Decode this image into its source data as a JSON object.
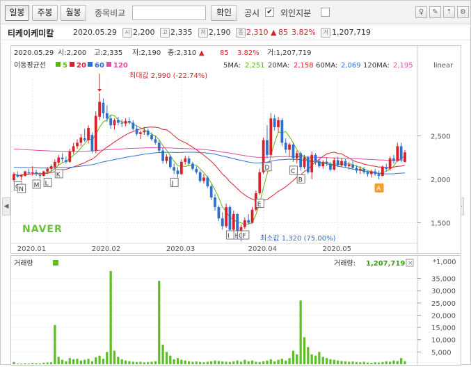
{
  "toolbar": {
    "periods": [
      "일봉",
      "주봉",
      "월봉"
    ],
    "compare_label": "종목비교",
    "confirm_label": "확인",
    "notice_label": "공시",
    "notice_checked": "✔",
    "foreign_label": "외인지분"
  },
  "info": {
    "name": "티케이케미칼",
    "date": "2020.05.29",
    "open_badge": "시",
    "open": "2,200",
    "high_badge": "고",
    "high": "2,335",
    "low_badge": "저",
    "low": "2,190",
    "close_badge": "종",
    "close": "2,310",
    "change_arrow": "▲",
    "change": "85",
    "change_pct": "3.82%",
    "volume_badge": "거",
    "volume": "1,207,719"
  },
  "price_pane": {
    "summary_date": "2020.05.29",
    "summary_open": "시:2,200",
    "summary_high": "고:2,335",
    "summary_low": "저:2,190",
    "summary_close": "종:2,310",
    "summary_arrow": "▲",
    "summary_change": "85",
    "summary_pct": "3.82%",
    "summary_volume": "거:1,207,719",
    "ma_title": "이동평균선",
    "ma_legend": [
      {
        "label": "5",
        "color": "#5bb516"
      },
      {
        "label": "20",
        "color": "#d6232a"
      },
      {
        "label": "60",
        "color": "#2f6fd0"
      },
      {
        "label": "120",
        "color": "#e24ba6"
      }
    ],
    "ma_values": [
      {
        "label": "5MA:",
        "value": "2,251",
        "color": "#5bb516"
      },
      {
        "label": "20MA:",
        "value": "2,158",
        "color": "#d6232a"
      },
      {
        "label": "60MA:",
        "value": "2,069",
        "color": "#2f6fd0"
      },
      {
        "label": "120MA:",
        "value": "2,195",
        "color": "#e24ba6"
      }
    ],
    "scale_label": "linear",
    "max_label": "최대값 2,990 (-22.74%)",
    "min_label": "최소값 1,320 (75.00%)",
    "logo": "NAVER"
  },
  "volume_pane": {
    "title": "거래량",
    "legend_label": "거래량:",
    "legend_value": "1,207,719",
    "unit": "*1,000"
  },
  "colors": {
    "up": "#d6232a",
    "down": "#2f6fd0",
    "ma5": "#5bb516",
    "ma20": "#d6232a",
    "ma60": "#2f6fd0",
    "ma120": "#e24ba6",
    "volume": "#5bbe24",
    "event": "#f0a030"
  },
  "chart_data": [
    {
      "type": "candlestick",
      "title": "티케이케미칼",
      "scale": "linear",
      "x_ticks": [
        "2020.01",
        "2020.02",
        "2020.03",
        "2020.04",
        "2020.05"
      ],
      "y_ticks": [
        1500,
        2000,
        2500
      ],
      "ylim": [
        1280,
        3150
      ],
      "candles": [
        {
          "d": "2019-12-23",
          "o": 1990,
          "h": 2080,
          "l": 1970,
          "c": 2060
        },
        {
          "d": "2019-12-24",
          "o": 2050,
          "h": 2090,
          "l": 2020,
          "c": 2030
        },
        {
          "d": "2019-12-26",
          "o": 2030,
          "h": 2060,
          "l": 1990,
          "c": 2050
        },
        {
          "d": "2019-12-27",
          "o": 2040,
          "h": 2100,
          "l": 2030,
          "c": 2090
        },
        {
          "d": "2019-12-30",
          "o": 2080,
          "h": 2120,
          "l": 2050,
          "c": 2070
        },
        {
          "d": "2020-01-02",
          "o": 2070,
          "h": 2150,
          "l": 2040,
          "c": 2080
        },
        {
          "d": "2020-01-03",
          "o": 2080,
          "h": 2110,
          "l": 2040,
          "c": 2060
        },
        {
          "d": "2020-01-06",
          "o": 2050,
          "h": 2080,
          "l": 2010,
          "c": 2040
        },
        {
          "d": "2020-01-07",
          "o": 2040,
          "h": 2100,
          "l": 2030,
          "c": 2090
        },
        {
          "d": "2020-01-08",
          "o": 2090,
          "h": 2140,
          "l": 2060,
          "c": 2120
        },
        {
          "d": "2020-01-09",
          "o": 2120,
          "h": 2170,
          "l": 2090,
          "c": 2150
        },
        {
          "d": "2020-01-10",
          "o": 2140,
          "h": 2230,
          "l": 2120,
          "c": 2200
        },
        {
          "d": "2020-01-13",
          "o": 2190,
          "h": 2280,
          "l": 2160,
          "c": 2250
        },
        {
          "d": "2020-01-14",
          "o": 2250,
          "h": 2300,
          "l": 2200,
          "c": 2230
        },
        {
          "d": "2020-01-15",
          "o": 2220,
          "h": 2260,
          "l": 2180,
          "c": 2200
        },
        {
          "d": "2020-01-16",
          "o": 2200,
          "h": 2350,
          "l": 2190,
          "c": 2320
        },
        {
          "d": "2020-01-17",
          "o": 2320,
          "h": 2420,
          "l": 2290,
          "c": 2380
        },
        {
          "d": "2020-01-20",
          "o": 2380,
          "h": 2460,
          "l": 2350,
          "c": 2420
        },
        {
          "d": "2020-01-21",
          "o": 2420,
          "h": 2520,
          "l": 2380,
          "c": 2480
        },
        {
          "d": "2020-01-22",
          "o": 2470,
          "h": 2580,
          "l": 2430,
          "c": 2450
        },
        {
          "d": "2020-01-23",
          "o": 2450,
          "h": 2620,
          "l": 2410,
          "c": 2590
        },
        {
          "d": "2020-01-28",
          "o": 2510,
          "h": 2540,
          "l": 2300,
          "c": 2330
        },
        {
          "d": "2020-01-29",
          "o": 2330,
          "h": 2780,
          "l": 2300,
          "c": 2730
        },
        {
          "d": "2020-01-30",
          "o": 2720,
          "h": 2990,
          "l": 2680,
          "c": 2890
        },
        {
          "d": "2020-01-31",
          "o": 2880,
          "h": 2930,
          "l": 2700,
          "c": 2760
        },
        {
          "d": "2020-02-03",
          "o": 2760,
          "h": 2850,
          "l": 2660,
          "c": 2700
        },
        {
          "d": "2020-02-04",
          "o": 2700,
          "h": 2740,
          "l": 2580,
          "c": 2620
        },
        {
          "d": "2020-02-05",
          "o": 2620,
          "h": 2700,
          "l": 2570,
          "c": 2680
        },
        {
          "d": "2020-02-06",
          "o": 2680,
          "h": 2720,
          "l": 2620,
          "c": 2650
        },
        {
          "d": "2020-02-07",
          "o": 2650,
          "h": 2690,
          "l": 2600,
          "c": 2640
        },
        {
          "d": "2020-02-10",
          "o": 2640,
          "h": 2700,
          "l": 2610,
          "c": 2670
        },
        {
          "d": "2020-02-11",
          "o": 2670,
          "h": 2710,
          "l": 2630,
          "c": 2650
        },
        {
          "d": "2020-02-12",
          "o": 2650,
          "h": 2680,
          "l": 2560,
          "c": 2580
        },
        {
          "d": "2020-02-13",
          "o": 2580,
          "h": 2620,
          "l": 2500,
          "c": 2520
        },
        {
          "d": "2020-02-14",
          "o": 2520,
          "h": 2560,
          "l": 2460,
          "c": 2540
        },
        {
          "d": "2020-02-17",
          "o": 2540,
          "h": 2600,
          "l": 2510,
          "c": 2560
        },
        {
          "d": "2020-02-18",
          "o": 2560,
          "h": 2580,
          "l": 2490,
          "c": 2510
        },
        {
          "d": "2020-02-19",
          "o": 2510,
          "h": 2540,
          "l": 2440,
          "c": 2460
        },
        {
          "d": "2020-02-20",
          "o": 2460,
          "h": 2500,
          "l": 2400,
          "c": 2420
        },
        {
          "d": "2020-02-21",
          "o": 2420,
          "h": 2450,
          "l": 2300,
          "c": 2330
        },
        {
          "d": "2020-02-24",
          "o": 2330,
          "h": 2360,
          "l": 2180,
          "c": 2210
        },
        {
          "d": "2020-02-25",
          "o": 2210,
          "h": 2290,
          "l": 2180,
          "c": 2260
        },
        {
          "d": "2020-02-26",
          "o": 2260,
          "h": 2280,
          "l": 2120,
          "c": 2140
        },
        {
          "d": "2020-02-27",
          "o": 2140,
          "h": 2180,
          "l": 2060,
          "c": 2100
        },
        {
          "d": "2020-02-28",
          "o": 2100,
          "h": 2140,
          "l": 2020,
          "c": 2060
        },
        {
          "d": "2020-03-02",
          "o": 2060,
          "h": 2230,
          "l": 2050,
          "c": 2200
        },
        {
          "d": "2020-03-03",
          "o": 2200,
          "h": 2270,
          "l": 2170,
          "c": 2240
        },
        {
          "d": "2020-03-04",
          "o": 2240,
          "h": 2270,
          "l": 2160,
          "c": 2180
        },
        {
          "d": "2020-03-05",
          "o": 2180,
          "h": 2200,
          "l": 2100,
          "c": 2120
        },
        {
          "d": "2020-03-06",
          "o": 2120,
          "h": 2150,
          "l": 2060,
          "c": 2080
        },
        {
          "d": "2020-03-09",
          "o": 2080,
          "h": 2100,
          "l": 1960,
          "c": 1980
        },
        {
          "d": "2020-03-10",
          "o": 1980,
          "h": 2060,
          "l": 1950,
          "c": 2020
        },
        {
          "d": "2020-03-11",
          "o": 2020,
          "h": 2040,
          "l": 1900,
          "c": 1920
        },
        {
          "d": "2020-03-12",
          "o": 1920,
          "h": 1940,
          "l": 1760,
          "c": 1790
        },
        {
          "d": "2020-03-13",
          "o": 1790,
          "h": 1830,
          "l": 1640,
          "c": 1680
        },
        {
          "d": "2020-03-16",
          "o": 1680,
          "h": 1700,
          "l": 1520,
          "c": 1550
        },
        {
          "d": "2020-03-17",
          "o": 1550,
          "h": 1620,
          "l": 1420,
          "c": 1460
        },
        {
          "d": "2020-03-18",
          "o": 1460,
          "h": 1720,
          "l": 1440,
          "c": 1680
        },
        {
          "d": "2020-03-19",
          "o": 1680,
          "h": 1700,
          "l": 1400,
          "c": 1420
        },
        {
          "d": "2020-03-20",
          "o": 1420,
          "h": 1640,
          "l": 1400,
          "c": 1600
        },
        {
          "d": "2020-03-23",
          "o": 1600,
          "h": 1610,
          "l": 1330,
          "c": 1360
        },
        {
          "d": "2020-03-24",
          "o": 1360,
          "h": 1480,
          "l": 1320,
          "c": 1450
        },
        {
          "d": "2020-03-25",
          "o": 1450,
          "h": 1560,
          "l": 1430,
          "c": 1530
        },
        {
          "d": "2020-03-26",
          "o": 1530,
          "h": 1600,
          "l": 1480,
          "c": 1500
        },
        {
          "d": "2020-03-27",
          "o": 1500,
          "h": 1680,
          "l": 1490,
          "c": 1650
        },
        {
          "d": "2020-03-30",
          "o": 1650,
          "h": 1870,
          "l": 1630,
          "c": 1840
        },
        {
          "d": "2020-03-31",
          "o": 1840,
          "h": 2120,
          "l": 1820,
          "c": 2080
        },
        {
          "d": "2020-04-01",
          "o": 2080,
          "h": 2480,
          "l": 2060,
          "c": 2450
        },
        {
          "d": "2020-04-02",
          "o": 2450,
          "h": 2620,
          "l": 2240,
          "c": 2280
        },
        {
          "d": "2020-04-03",
          "o": 2280,
          "h": 2760,
          "l": 2260,
          "c": 2700
        },
        {
          "d": "2020-04-06",
          "o": 2700,
          "h": 2740,
          "l": 2560,
          "c": 2600
        },
        {
          "d": "2020-04-07",
          "o": 2600,
          "h": 2720,
          "l": 2540,
          "c": 2680
        },
        {
          "d": "2020-04-08",
          "o": 2680,
          "h": 2700,
          "l": 2380,
          "c": 2420
        },
        {
          "d": "2020-04-09",
          "o": 2420,
          "h": 2470,
          "l": 2300,
          "c": 2340
        },
        {
          "d": "2020-04-10",
          "o": 2340,
          "h": 2420,
          "l": 2260,
          "c": 2400
        },
        {
          "d": "2020-04-13",
          "o": 2400,
          "h": 2420,
          "l": 2200,
          "c": 2240
        },
        {
          "d": "2020-04-14",
          "o": 2240,
          "h": 2330,
          "l": 2180,
          "c": 2300
        },
        {
          "d": "2020-04-16",
          "o": 2300,
          "h": 2320,
          "l": 2100,
          "c": 2140
        },
        {
          "d": "2020-04-17",
          "o": 2140,
          "h": 2280,
          "l": 2120,
          "c": 2250
        },
        {
          "d": "2020-04-20",
          "o": 2250,
          "h": 2270,
          "l": 2060,
          "c": 2080
        },
        {
          "d": "2020-04-21",
          "o": 2080,
          "h": 2320,
          "l": 2000,
          "c": 2280
        },
        {
          "d": "2020-04-22",
          "o": 2280,
          "h": 2300,
          "l": 2170,
          "c": 2210
        },
        {
          "d": "2020-04-23",
          "o": 2210,
          "h": 2230,
          "l": 2130,
          "c": 2150
        },
        {
          "d": "2020-04-24",
          "o": 2150,
          "h": 2220,
          "l": 2120,
          "c": 2200
        },
        {
          "d": "2020-04-27",
          "o": 2200,
          "h": 2250,
          "l": 2150,
          "c": 2180
        },
        {
          "d": "2020-04-28",
          "o": 2180,
          "h": 2200,
          "l": 2090,
          "c": 2110
        },
        {
          "d": "2020-04-29",
          "o": 2110,
          "h": 2250,
          "l": 2100,
          "c": 2220
        },
        {
          "d": "2020-05-04",
          "o": 2220,
          "h": 2260,
          "l": 2140,
          "c": 2160
        },
        {
          "d": "2020-05-06",
          "o": 2160,
          "h": 2240,
          "l": 2140,
          "c": 2210
        },
        {
          "d": "2020-05-07",
          "o": 2210,
          "h": 2230,
          "l": 2130,
          "c": 2150
        },
        {
          "d": "2020-05-08",
          "o": 2150,
          "h": 2200,
          "l": 2110,
          "c": 2170
        },
        {
          "d": "2020-05-11",
          "o": 2170,
          "h": 2220,
          "l": 2110,
          "c": 2130
        },
        {
          "d": "2020-05-12",
          "o": 2130,
          "h": 2160,
          "l": 2070,
          "c": 2100
        },
        {
          "d": "2020-05-13",
          "o": 2100,
          "h": 2150,
          "l": 2060,
          "c": 2120
        },
        {
          "d": "2020-05-14",
          "o": 2120,
          "h": 2140,
          "l": 2060,
          "c": 2080
        },
        {
          "d": "2020-05-15",
          "o": 2080,
          "h": 2100,
          "l": 2030,
          "c": 2060
        },
        {
          "d": "2020-05-18",
          "o": 2060,
          "h": 2110,
          "l": 2020,
          "c": 2090
        },
        {
          "d": "2020-05-19",
          "o": 2090,
          "h": 2120,
          "l": 2040,
          "c": 2060
        },
        {
          "d": "2020-05-20",
          "o": 2060,
          "h": 2100,
          "l": 2000,
          "c": 2040
        },
        {
          "d": "2020-05-21",
          "o": 2040,
          "h": 2160,
          "l": 2030,
          "c": 2140
        },
        {
          "d": "2020-05-22",
          "o": 2140,
          "h": 2180,
          "l": 2090,
          "c": 2120
        },
        {
          "d": "2020-05-25",
          "o": 2120,
          "h": 2260,
          "l": 2100,
          "c": 2240
        },
        {
          "d": "2020-05-26",
          "o": 2240,
          "h": 2280,
          "l": 2180,
          "c": 2210
        },
        {
          "d": "2020-05-27",
          "o": 2210,
          "h": 2420,
          "l": 2200,
          "c": 2380
        },
        {
          "d": "2020-05-28",
          "o": 2380,
          "h": 2420,
          "l": 2200,
          "c": 2225
        },
        {
          "d": "2020-05-29",
          "o": 2200,
          "h": 2335,
          "l": 2190,
          "c": 2310
        }
      ],
      "moving_averages": [
        {
          "name": "5",
          "period": 5
        },
        {
          "name": "20",
          "period": 20
        },
        {
          "name": "60",
          "period": 60
        },
        {
          "name": "120",
          "period": 120
        }
      ],
      "events": [
        {
          "label": "C",
          "d": "2019-12-24"
        },
        {
          "label": "N",
          "d": "2019-12-26"
        },
        {
          "label": "M",
          "d": "2020-01-03"
        },
        {
          "label": "L",
          "d": "2020-01-08"
        },
        {
          "label": "K",
          "d": "2020-01-13"
        },
        {
          "label": "J",
          "d": "2020-02-27"
        },
        {
          "label": "I",
          "d": "2020-03-19"
        },
        {
          "label": "H",
          "d": "2020-03-23"
        },
        {
          "label": "G",
          "d": "2020-03-24"
        },
        {
          "label": "F",
          "d": "2020-03-25"
        },
        {
          "label": "E",
          "d": "2020-03-31"
        },
        {
          "label": "D",
          "d": "2020-04-02"
        },
        {
          "label": "C",
          "d": "2020-04-13"
        },
        {
          "label": "B",
          "d": "2020-04-16"
        },
        {
          "label": "A",
          "d": "2020-05-20",
          "highlight": true
        }
      ]
    },
    {
      "type": "bar",
      "title": "거래량",
      "unit": "*1,000",
      "y_ticks": [
        5000,
        10000,
        15000,
        20000,
        25000,
        30000,
        35000
      ],
      "ylim": [
        0,
        38000
      ],
      "values": [
        900,
        300,
        250,
        400,
        300,
        500,
        450,
        350,
        600,
        700,
        800,
        16000,
        3000,
        1800,
        1200,
        2500,
        2000,
        2200,
        1500,
        1800,
        2200,
        1200,
        2800,
        3500,
        2200,
        5000,
        38000,
        5500,
        3000,
        2000,
        1500,
        1200,
        1000,
        900,
        1000,
        800,
        900,
        1000,
        1200,
        34000,
        8000,
        5000,
        3500,
        2000,
        2500,
        1800,
        1500,
        1200,
        1000,
        1100,
        900,
        800,
        1000,
        1200,
        1500,
        1300,
        1100,
        1000,
        900,
        1200,
        1500,
        1000,
        1800,
        1200,
        1500,
        1000,
        900,
        1200,
        1500,
        2000,
        1200,
        1800,
        2200,
        1500,
        2500,
        5500,
        4000,
        26000,
        11000,
        7000,
        4000,
        3500,
        5000,
        3000,
        2500,
        2000,
        1800,
        1500,
        1300,
        1200,
        1000,
        1100,
        900,
        800,
        1000,
        700,
        600,
        800,
        700,
        900,
        1200,
        1000,
        1500,
        1300,
        2500,
        1207
      ]
    }
  ]
}
